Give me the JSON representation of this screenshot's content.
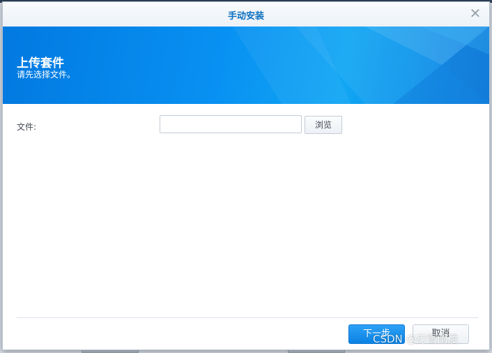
{
  "dialog": {
    "title": "手动安装",
    "close_icon": "close-icon"
  },
  "banner": {
    "title": "上传套件",
    "subtitle": "请先选择文件。",
    "colors": {
      "start": "#0279e0",
      "end": "#11a6f4"
    }
  },
  "form": {
    "file_label": "文件:",
    "file_value": "",
    "browse_label": "浏览"
  },
  "footer": {
    "next_label": "下一步",
    "cancel_label": "取消"
  },
  "watermark": "CSDN @刃雪雨凌",
  "colors": {
    "accent": "#0b6fbf",
    "primary_button": "#1584e6"
  }
}
